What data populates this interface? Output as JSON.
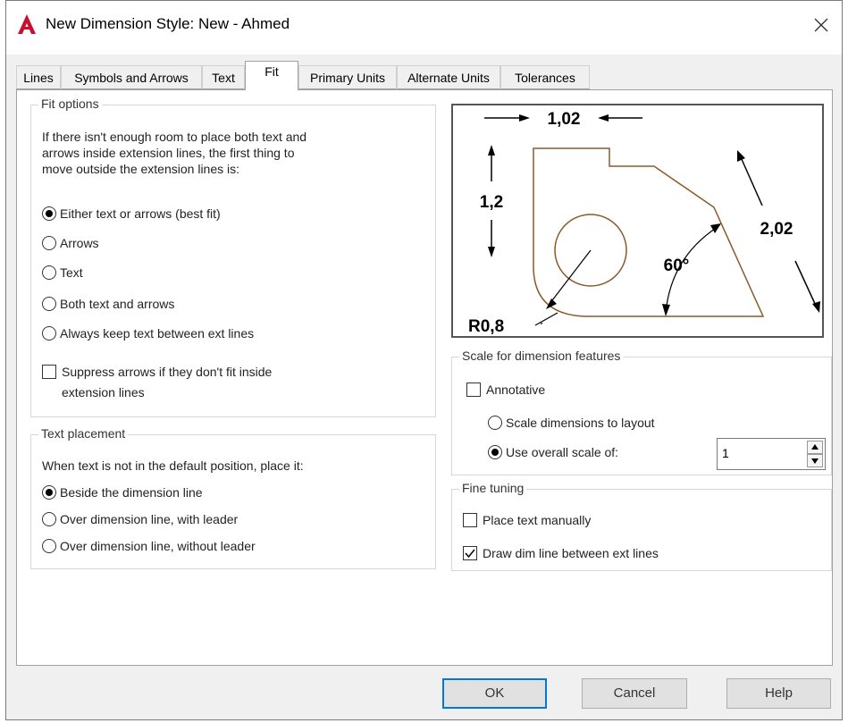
{
  "window": {
    "title": "New Dimension Style: New - Ahmed"
  },
  "tabs": [
    {
      "label": "Lines"
    },
    {
      "label": "Symbols and Arrows"
    },
    {
      "label": "Text"
    },
    {
      "label": "Fit",
      "active": true
    },
    {
      "label": "Primary Units"
    },
    {
      "label": "Alternate Units"
    },
    {
      "label": "Tolerances"
    }
  ],
  "fit_options": {
    "title": "Fit options",
    "description": [
      "If there isn't enough room to place both text and",
      "arrows inside extension lines, the first thing to",
      "move outside the extension lines is:"
    ],
    "options": [
      {
        "label": "Either text or arrows (best fit)",
        "selected": true
      },
      {
        "label": "Arrows",
        "selected": false
      },
      {
        "label": "Text",
        "selected": false
      },
      {
        "label": "Both text and arrows",
        "selected": false
      },
      {
        "label": "Always keep text between ext lines",
        "selected": false
      }
    ],
    "suppress": {
      "label_line1": "Suppress arrows if they don't fit inside",
      "label_line2": "extension lines",
      "checked": false
    }
  },
  "text_placement": {
    "title": "Text placement",
    "description": "When text is not in the default position, place it:",
    "options": [
      {
        "label": "Beside the dimension line",
        "selected": true
      },
      {
        "label": "Over dimension line, with leader",
        "selected": false
      },
      {
        "label": "Over dimension line, without leader",
        "selected": false
      }
    ]
  },
  "preview": {
    "dims": {
      "top": "1,02",
      "left": "1,2",
      "right": "2,02",
      "angle": "60°",
      "radius": "R0,8"
    },
    "line_color": "#8b5a2b"
  },
  "scale": {
    "title": "Scale for dimension features",
    "annotative": {
      "label": "Annotative",
      "checked": false
    },
    "to_layout": {
      "label": "Scale dimensions to layout",
      "selected": false
    },
    "overall": {
      "label": "Use overall scale of:",
      "selected": true,
      "value": "1"
    }
  },
  "fine_tuning": {
    "title": "Fine tuning",
    "manual": {
      "label": "Place text manually",
      "checked": false
    },
    "draw_dim": {
      "label": "Draw dim line between ext lines",
      "checked": true
    }
  },
  "buttons": {
    "ok": "OK",
    "cancel": "Cancel",
    "help": "Help"
  },
  "colors": {
    "accent": "#0078d7",
    "app_icon": "#c8102e"
  }
}
